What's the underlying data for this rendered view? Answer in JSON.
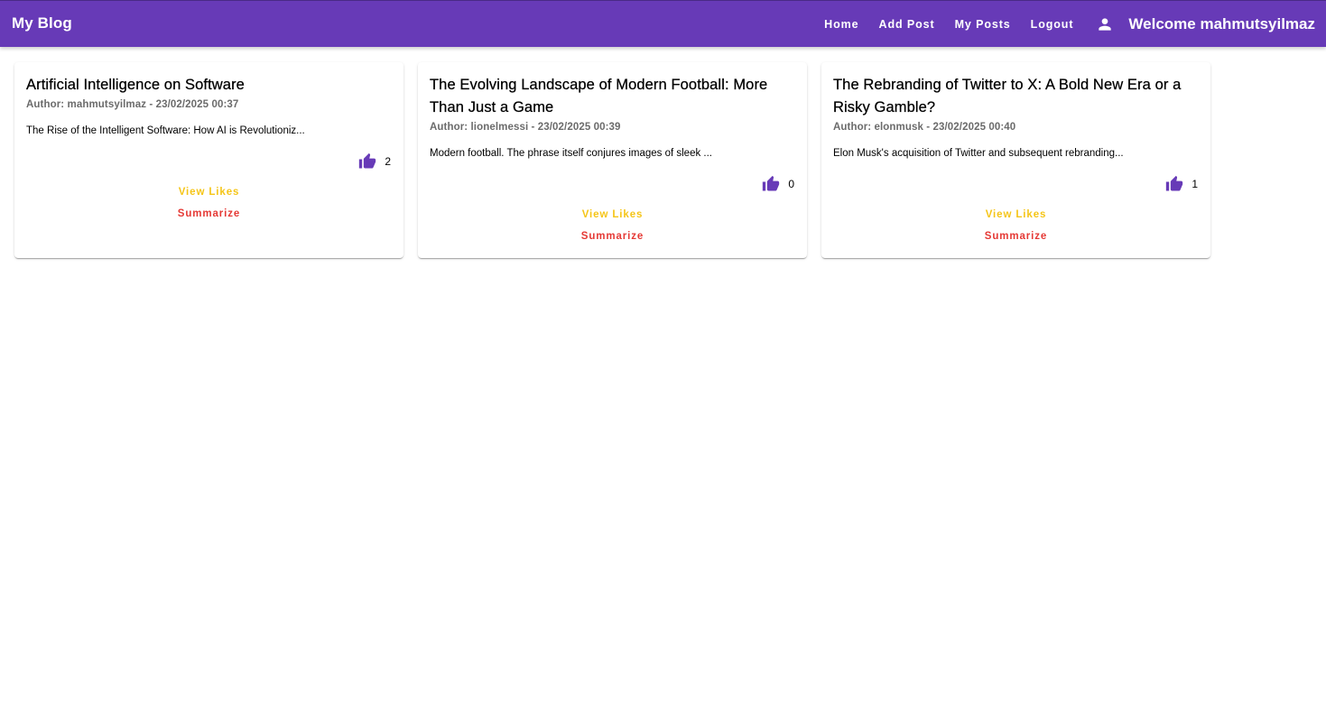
{
  "header": {
    "brand": "My Blog",
    "nav": [
      "Home",
      "Add Post",
      "My Posts",
      "Logout"
    ],
    "welcome": "Welcome mahmutsyilmaz",
    "user_icon": "person-icon"
  },
  "posts": [
    {
      "title": "Artificial Intelligence on Software",
      "meta": "Author: mahmutsyilmaz - 23/02/2025 00:37",
      "excerpt": "The Rise of the Intelligent Software: How AI is Revolutioniz...",
      "likes": "2",
      "view_likes": "View Likes",
      "summarize": "Summarize"
    },
    {
      "title": "The Evolving Landscape of Modern Football: More Than Just a Game",
      "meta": "Author: lionelmessi - 23/02/2025 00:39",
      "excerpt": "Modern football. The phrase itself conjures images of sleek ...",
      "likes": "0",
      "view_likes": "View Likes",
      "summarize": "Summarize"
    },
    {
      "title": "The Rebranding of Twitter to X: A Bold New Era or a Risky Gamble?",
      "meta": "Author: elonmusk - 23/02/2025 00:40",
      "excerpt": "Elon Musk's acquisition of Twitter and subsequent rebranding...",
      "likes": "1",
      "view_likes": "View Likes",
      "summarize": "Summarize"
    }
  ],
  "colors": {
    "primary": "#673ab7",
    "view_likes": "#f5c518",
    "summarize": "#e53935"
  },
  "icons": {
    "like": "thumb-up-icon"
  }
}
